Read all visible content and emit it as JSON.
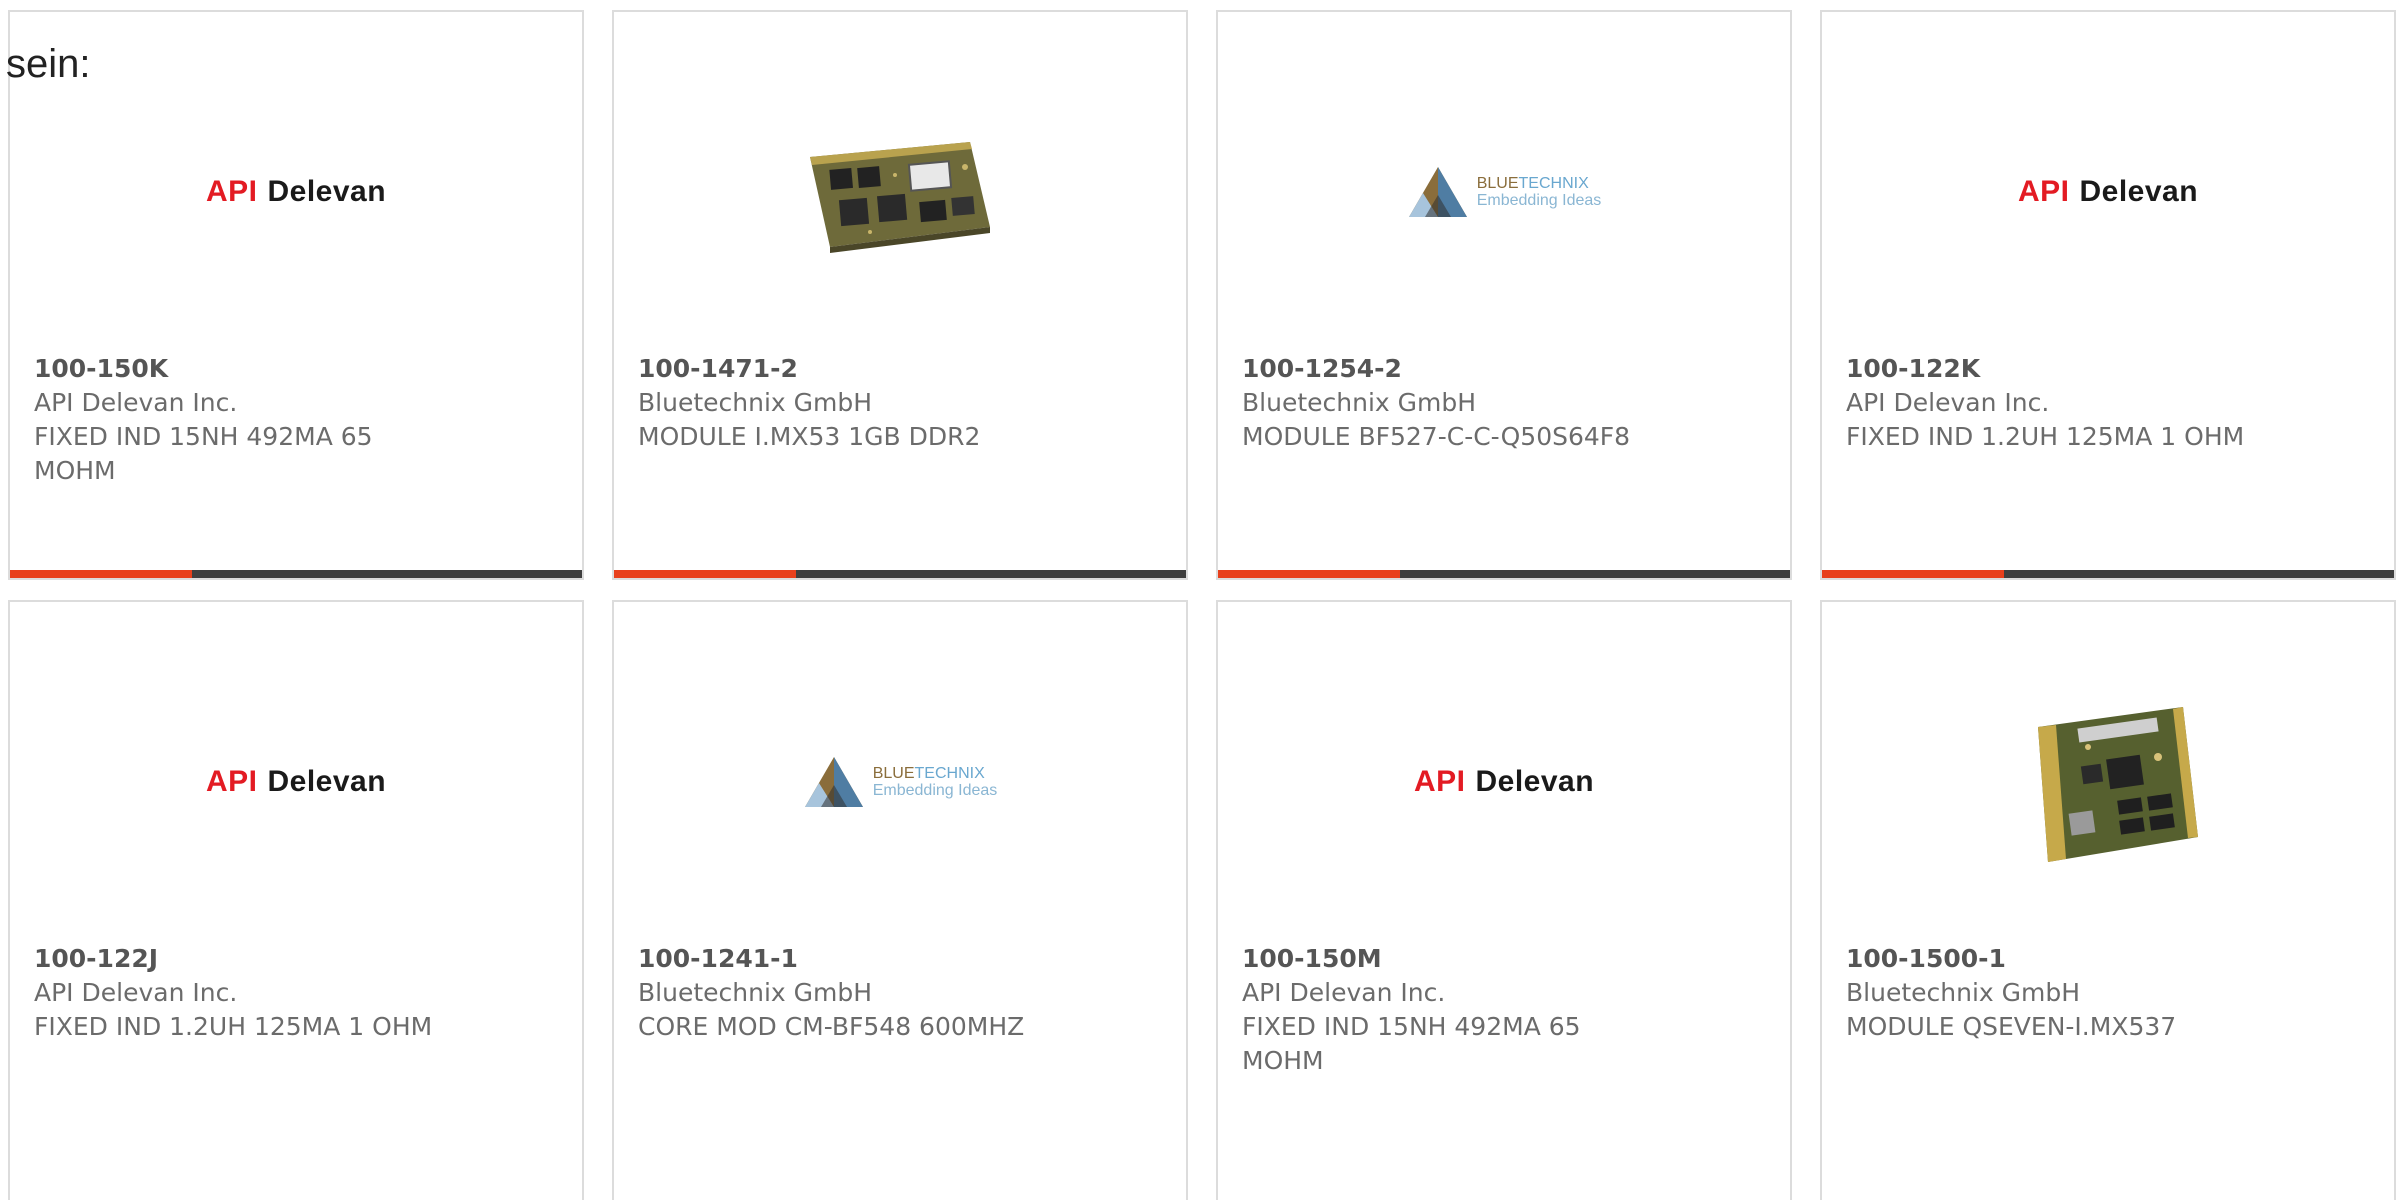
{
  "leading_text": "sein:",
  "colors": {
    "accent": "#e8401c",
    "bar": "#3f3f3f",
    "card_border": "#dcdcdc",
    "api_red": "#e31b23"
  },
  "products": [
    {
      "part_number": "100-150K",
      "manufacturer": "API Delevan Inc.",
      "description": "FIXED IND 15NH 492MA 65 MOHM",
      "image": "api-delevan-logo",
      "logo_text": [
        "API",
        "Delevan"
      ]
    },
    {
      "part_number": "100-1471-2",
      "manufacturer": "Bluetechnix GmbH",
      "description": "MODULE I.MX53 1GB DDR2",
      "image": "circuit-board-photo"
    },
    {
      "part_number": "100-1254-2",
      "manufacturer": "Bluetechnix GmbH",
      "description": "MODULE BF527-C-C-Q50S64F8",
      "image": "bluetechnix-logo",
      "logo_text": [
        "BLUE",
        "TECHNIX",
        "Embedding Ideas"
      ]
    },
    {
      "part_number": "100-122K",
      "manufacturer": "API Delevan Inc.",
      "description": "FIXED IND 1.2UH 125MA 1 OHM",
      "image": "api-delevan-logo",
      "logo_text": [
        "API",
        "Delevan"
      ]
    },
    {
      "part_number": "100-122J",
      "manufacturer": "API Delevan Inc.",
      "description": "FIXED IND 1.2UH 125MA 1 OHM",
      "image": "api-delevan-logo",
      "logo_text": [
        "API",
        "Delevan"
      ]
    },
    {
      "part_number": "100-1241-1",
      "manufacturer": "Bluetechnix GmbH",
      "description": "CORE MOD CM-BF548 600MHZ",
      "image": "bluetechnix-logo",
      "logo_text": [
        "BLUE",
        "TECHNIX",
        "Embedding Ideas"
      ]
    },
    {
      "part_number": "100-150M",
      "manufacturer": "API Delevan Inc.",
      "description": "FIXED IND 15NH 492MA 65 MOHM",
      "image": "api-delevan-logo",
      "logo_text": [
        "API",
        "Delevan"
      ]
    },
    {
      "part_number": "100-1500-1",
      "manufacturer": "Bluetechnix GmbH",
      "description": "MODULE QSEVEN-I.MX537",
      "image": "circuit-board-photo"
    }
  ]
}
